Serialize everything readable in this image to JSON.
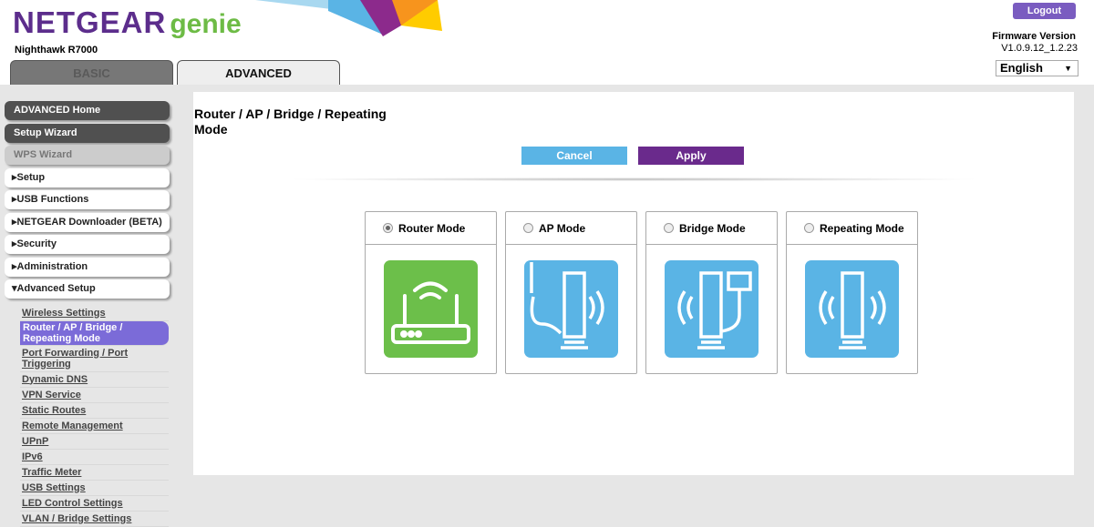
{
  "header": {
    "brand": "NETGEAR",
    "brand_suffix": "genie",
    "model": "Nighthawk R7000",
    "logout": "Logout",
    "firmware_label": "Firmware Version",
    "firmware_version": "V1.0.9.12_1.2.23",
    "language": "English"
  },
  "tabs": [
    {
      "label": "BASIC"
    },
    {
      "label": "ADVANCED"
    }
  ],
  "sidebar": {
    "buttons": [
      {
        "label": "ADVANCED Home"
      },
      {
        "label": "Setup Wizard"
      },
      {
        "label": "WPS Wizard"
      }
    ],
    "sections": [
      {
        "label": "Setup"
      },
      {
        "label": "USB Functions"
      },
      {
        "label": "NETGEAR Downloader (BETA)"
      },
      {
        "label": "Security"
      },
      {
        "label": "Administration"
      },
      {
        "label": "Advanced Setup"
      }
    ],
    "subitems": [
      {
        "label": "Wireless Settings"
      },
      {
        "label": "Router / AP / Bridge / Repeating Mode"
      },
      {
        "label": "Port Forwarding / Port Triggering"
      },
      {
        "label": "Dynamic DNS"
      },
      {
        "label": "VPN Service"
      },
      {
        "label": "Static Routes"
      },
      {
        "label": "Remote Management"
      },
      {
        "label": "UPnP"
      },
      {
        "label": "IPv6"
      },
      {
        "label": "Traffic Meter"
      },
      {
        "label": "USB Settings"
      },
      {
        "label": "LED Control Settings"
      },
      {
        "label": "VLAN / Bridge Settings"
      }
    ]
  },
  "main": {
    "title": "Router / AP / Bridge / Repeating Mode",
    "cancel": "Cancel",
    "apply": "Apply",
    "modes": [
      {
        "label": "Router Mode",
        "selected": true,
        "color": "#6cbf4a"
      },
      {
        "label": "AP Mode",
        "selected": false,
        "color": "#5ab4e5"
      },
      {
        "label": "Bridge Mode",
        "selected": false,
        "color": "#5ab4e5"
      },
      {
        "label": "Repeating Mode",
        "selected": false,
        "color": "#5ab4e5"
      }
    ]
  }
}
